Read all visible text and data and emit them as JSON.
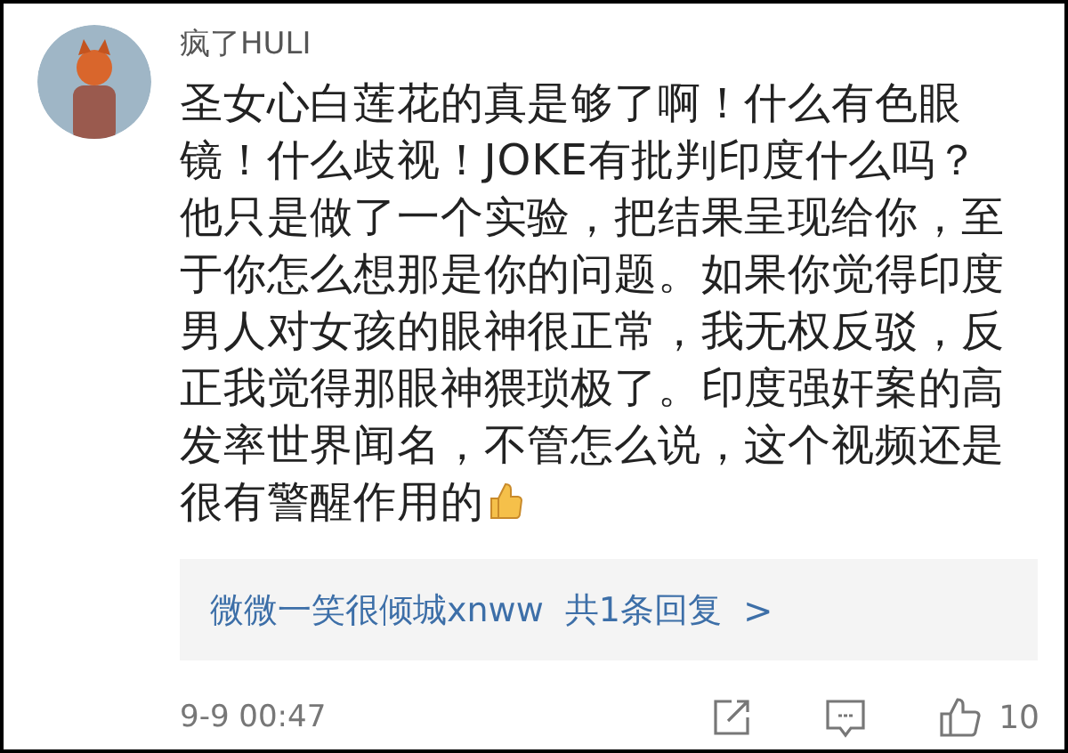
{
  "comment": {
    "username": "疯了HULI",
    "text_lines": [
      "圣女心白莲花的真是够了啊！什么有色眼",
      "镜！什么歧视！JOKE有批判印度什么吗？",
      "他只是做了一个实验，把结果呈现给你，至",
      "于你怎么想那是你的问题。如果你觉得印度",
      "男人对女孩的眼神很正常，我无权反驳，反",
      "正我觉得那眼神猥琐极了。印度强奸案的高",
      "发率世界闻名，不管怎么说，这个视频还是",
      "很有警醒作用的"
    ],
    "reply_preview": {
      "user": "微微一笑很倾城xnww",
      "count": "共1条回复",
      "arrow": ">"
    },
    "time": "9-9 00:47",
    "likes": "10"
  }
}
